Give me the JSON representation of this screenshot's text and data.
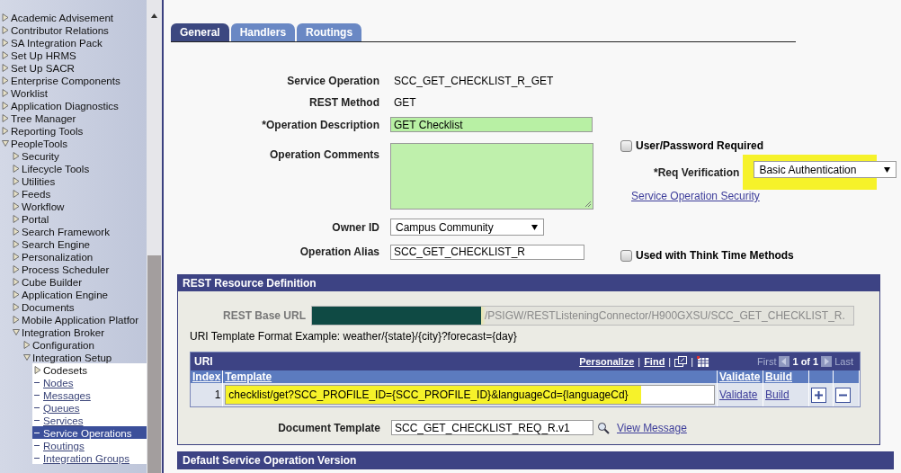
{
  "menu": {
    "items": [
      {
        "label": "Academic Advisement",
        "kind": "folder",
        "expanded": false
      },
      {
        "label": "Contributor Relations",
        "kind": "folder",
        "expanded": false
      },
      {
        "label": "SA Integration Pack",
        "kind": "folder",
        "expanded": false
      },
      {
        "label": "Set Up HRMS",
        "kind": "folder",
        "expanded": false
      },
      {
        "label": "Set Up SACR",
        "kind": "folder",
        "expanded": false
      },
      {
        "label": "Enterprise Components",
        "kind": "folder",
        "expanded": false
      },
      {
        "label": "Worklist",
        "kind": "folder",
        "expanded": false
      },
      {
        "label": "Application Diagnostics",
        "kind": "folder",
        "expanded": false
      },
      {
        "label": "Tree Manager",
        "kind": "folder",
        "expanded": false
      },
      {
        "label": "Reporting Tools",
        "kind": "folder",
        "expanded": false
      },
      {
        "label": "PeopleTools",
        "kind": "folder",
        "expanded": true,
        "children": [
          {
            "label": "Security",
            "kind": "folder",
            "expanded": false
          },
          {
            "label": "Lifecycle Tools",
            "kind": "folder",
            "expanded": false
          },
          {
            "label": "Utilities",
            "kind": "folder",
            "expanded": false
          },
          {
            "label": "Feeds",
            "kind": "folder",
            "expanded": false
          },
          {
            "label": "Workflow",
            "kind": "folder",
            "expanded": false
          },
          {
            "label": "Portal",
            "kind": "folder",
            "expanded": false
          },
          {
            "label": "Search Framework",
            "kind": "folder",
            "expanded": false
          },
          {
            "label": "Search Engine",
            "kind": "folder",
            "expanded": false
          },
          {
            "label": "Personalization",
            "kind": "folder",
            "expanded": false
          },
          {
            "label": "Process Scheduler",
            "kind": "folder",
            "expanded": false
          },
          {
            "label": "Cube Builder",
            "kind": "folder",
            "expanded": false
          },
          {
            "label": "Application Engine",
            "kind": "folder",
            "expanded": false
          },
          {
            "label": "Documents",
            "kind": "folder",
            "expanded": false
          },
          {
            "label": "Mobile Application Platfor",
            "kind": "folder",
            "expanded": false
          },
          {
            "label": "Integration Broker",
            "kind": "folder",
            "expanded": true,
            "children": [
              {
                "label": "Configuration",
                "kind": "folder",
                "expanded": false
              },
              {
                "label": "Integration Setup",
                "kind": "folder",
                "expanded": true,
                "children": [
                  {
                    "label": "Codesets",
                    "kind": "folder",
                    "expanded": false
                  },
                  {
                    "label": "Nodes",
                    "kind": "link",
                    "selected": false
                  },
                  {
                    "label": "Messages",
                    "kind": "link",
                    "selected": false
                  },
                  {
                    "label": "Queues",
                    "kind": "link",
                    "selected": false
                  },
                  {
                    "label": "Services",
                    "kind": "link",
                    "selected": false
                  },
                  {
                    "label": "Service Operations",
                    "kind": "link",
                    "selected": true
                  },
                  {
                    "label": "Routings",
                    "kind": "link",
                    "selected": false
                  },
                  {
                    "label": "Integration Groups",
                    "kind": "link",
                    "selected": false
                  }
                ]
              }
            ]
          }
        ]
      }
    ]
  },
  "tabs": [
    {
      "label": "General",
      "selected": true
    },
    {
      "label": "Handlers",
      "selected": false
    },
    {
      "label": "Routings",
      "selected": false
    }
  ],
  "form": {
    "fields": [
      {
        "label": "Service Operation",
        "kind": "text",
        "value": "SCC_GET_CHECKLIST_R_GET"
      },
      {
        "label": "REST Method",
        "kind": "text",
        "value": "GET"
      },
      {
        "label": "*Operation Description",
        "kind": "input",
        "value": "GET Checklist",
        "required": true
      },
      {
        "label": "Operation Comments",
        "kind": "textarea",
        "required": true
      },
      {
        "label": "Owner ID",
        "kind": "select",
        "value": "Campus Community"
      },
      {
        "label": "Operation Alias",
        "kind": "input",
        "value": "SCC_GET_CHECKLIST_R",
        "required": false
      }
    ]
  },
  "options": {
    "user_password": {
      "label": "User/Password Required",
      "checked": false
    },
    "req_verification": {
      "label": "*Req Verification",
      "value": "Basic Authentication",
      "highlighted": true
    },
    "security_link": "Service Operation Security",
    "think_time": {
      "label": "Used with Think Time Methods",
      "checked": false
    }
  },
  "rest_resource": {
    "title": "REST Resource Definition",
    "base_url": {
      "label": "REST Base URL",
      "value": "/PSIGW/RESTListeningConnector/H900GXSU/SCC_GET_CHECKLIST_R.",
      "redacted": true
    },
    "example": "URI Template Format Example: weather/{state}/{city}?forecast={day}",
    "uri_grid": {
      "title": "URI",
      "nav": [
        {
          "kind": "link",
          "text": "Personalize"
        },
        {
          "kind": "sep",
          "text": "|"
        },
        {
          "kind": "link",
          "text": "Find"
        },
        {
          "kind": "sep",
          "text": "|"
        },
        {
          "kind": "zoom"
        },
        {
          "kind": "sep",
          "text": "|"
        },
        {
          "kind": "download"
        }
      ],
      "first": {
        "text": "First",
        "disabled": true
      },
      "range": "1 of 1",
      "last": {
        "text": "Last",
        "disabled": true
      },
      "columns": [
        "Index",
        "Template",
        "Validate",
        "Build"
      ],
      "rows": [
        {
          "index": "1",
          "template": "checklist/get?SCC_PROFILE_ID={SCC_PROFILE_ID}&languageCd={languageCd}",
          "highlighted": true,
          "validate": "Validate",
          "build": "Build"
        }
      ]
    },
    "document_template": {
      "label": "Document Template",
      "value": "SCC_GET_CHECKLIST_REQ_R.v1",
      "link": "View Message"
    }
  },
  "default_version": {
    "title": "Default Service Operation Version"
  }
}
